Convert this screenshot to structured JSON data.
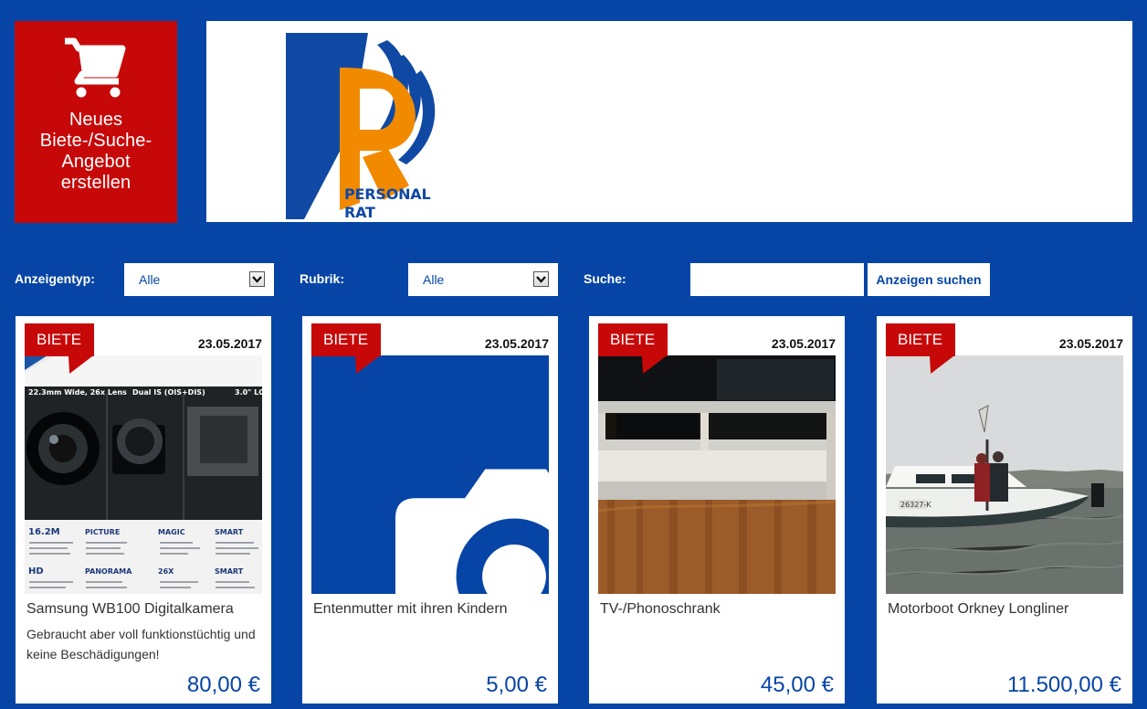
{
  "colors": {
    "background": "#0645a6",
    "accent_red": "#c70808",
    "price_blue": "#0645a6",
    "logo_orange": "#f28a00",
    "logo_blue": "#1049a4"
  },
  "header": {
    "create_offer": {
      "icon": "shopping-cart-icon",
      "label": "Neues\nBiete-/Suche-\nAngebot\nerstellen"
    },
    "logo": {
      "text": "PERSONAL\nRAT"
    }
  },
  "filters": {
    "ad_type": {
      "label": "Anzeigentyp:",
      "selected": "Alle"
    },
    "category": {
      "label": "Rubrik:",
      "selected": "Alle"
    },
    "search": {
      "label": "Suche:",
      "value": "",
      "placeholder": "",
      "button": "Anzeigen suchen"
    }
  },
  "listings": [
    {
      "badge": "BIETE",
      "date": "23.05.2017",
      "title": "Samsung WB100 Digitalkamera",
      "description": "Gebraucht aber voll funktionstüchtig und keine Beschädigungen!",
      "price": "80,00 €",
      "image": "camera-brochure-image"
    },
    {
      "badge": "BIETE",
      "date": "23.05.2017",
      "title": "Entenmutter mit ihren Kindern",
      "description": "",
      "price": "5,00 €",
      "image": "camera-placeholder-icon"
    },
    {
      "badge": "BIETE",
      "date": "23.05.2017",
      "title": "TV-/Phonoschrank",
      "description": "",
      "price": "45,00 €",
      "image": "tv-cabinet-image"
    },
    {
      "badge": "BIETE",
      "date": "23.05.2017",
      "title": "Motorboot Orkney Longliner",
      "description": "",
      "price": "11.500,00 €",
      "image": "motorboat-image"
    }
  ]
}
